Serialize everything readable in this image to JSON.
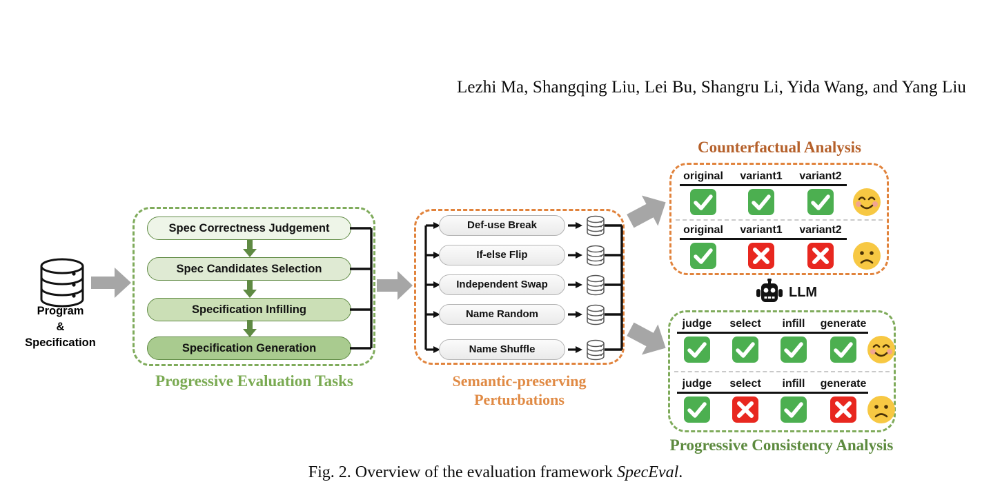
{
  "page": {
    "authors": "Lezhi Ma, Shangqing Liu, Lei Bu, Shangru Li, Yida Wang, and Yang Liu",
    "caption_prefix": "Fig. 2.  Overview of the evaluation framework ",
    "caption_italic": "SpecEval",
    "caption_suffix": "."
  },
  "colors": {
    "green_dash": "#7fab5b",
    "orange_dash": "#e1833c",
    "title_green": "#7aaa52",
    "title_orange": "#e08a44",
    "title_sienna": "#b5602a",
    "title_dark_green": "#5c8a3e",
    "check_green": "#4caf50",
    "cross_red": "#e8271f",
    "emoji_yellow": "#f7c843",
    "arrow_gray": "#a6a6a6"
  },
  "source": {
    "icon": "database-icon",
    "label_line1": "Program",
    "label_line2": "&",
    "label_line3": "Specification"
  },
  "tasks_panel": {
    "title": "Progressive Evaluation Tasks",
    "items": [
      {
        "label": "Spec Correctness Judgement",
        "shade": "t1"
      },
      {
        "label": "Spec Candidates Selection",
        "shade": "t2"
      },
      {
        "label": "Specification Infilling",
        "shade": "t3"
      },
      {
        "label": "Specification Generation",
        "shade": "t4"
      }
    ]
  },
  "perturbations_panel": {
    "title_line1": "Semantic-preserving",
    "title_line2": "Perturbations",
    "items": [
      {
        "label": "Def-use Break",
        "icon": "database-icon"
      },
      {
        "label": "If-else Flip",
        "icon": "database-icon"
      },
      {
        "label": "Independent Swap",
        "icon": "database-icon"
      },
      {
        "label": "Name Random",
        "icon": "database-icon"
      },
      {
        "label": "Name Shuffle",
        "icon": "database-icon"
      }
    ]
  },
  "llm": {
    "icon": "robot-icon",
    "label": "LLM"
  },
  "counterfactual_panel": {
    "title": "Counterfactual Analysis",
    "rows": [
      {
        "headers": [
          "original",
          "variant1",
          "variant2"
        ],
        "marks": [
          "check",
          "check",
          "check"
        ],
        "face": "happy"
      },
      {
        "headers": [
          "original",
          "variant1",
          "variant2"
        ],
        "marks": [
          "check",
          "cross",
          "cross"
        ],
        "face": "sad"
      }
    ]
  },
  "consistency_panel": {
    "title": "Progressive Consistency Analysis",
    "rows": [
      {
        "headers": [
          "judge",
          "select",
          "infill",
          "generate"
        ],
        "marks": [
          "check",
          "check",
          "check",
          "check"
        ],
        "face": "happy"
      },
      {
        "headers": [
          "judge",
          "select",
          "infill",
          "generate"
        ],
        "marks": [
          "check",
          "cross",
          "check",
          "cross"
        ],
        "face": "sad"
      }
    ]
  }
}
